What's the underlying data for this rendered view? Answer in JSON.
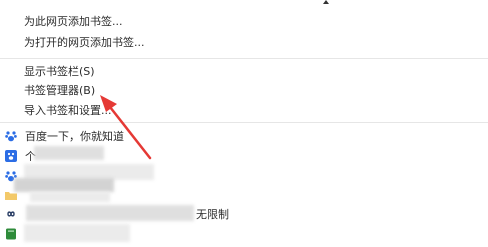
{
  "menu": {
    "items": [
      {
        "label": "为此网页添加书签..."
      },
      {
        "label": "为打开的网页添加书签..."
      },
      {
        "label": "显示书签栏(S)"
      },
      {
        "label": "书签管理器(B)"
      },
      {
        "label": "导入书签和设置..."
      }
    ]
  },
  "bookmarks": [
    {
      "label": "百度一下，你就知道",
      "icon": "baidu-paw-icon"
    },
    {
      "label": "个",
      "icon": "baidu-square-icon"
    },
    {
      "label": "",
      "icon": "baidu-paw-icon"
    },
    {
      "label": "",
      "icon": "folder-icon"
    },
    {
      "label": "无限制",
      "icon": "infinity-link-icon"
    },
    {
      "label": "",
      "icon": "green-book-icon"
    }
  ],
  "colors": {
    "accent_red": "#e53935",
    "baidu_blue": "#2b6de5",
    "separator": "#e6e6e6"
  }
}
